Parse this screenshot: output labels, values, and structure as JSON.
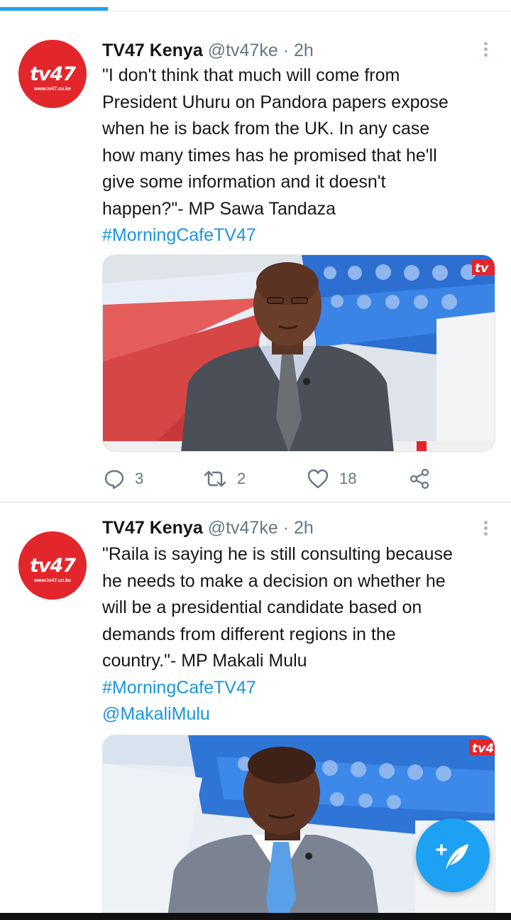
{
  "tweets": [
    {
      "name": "TV47 Kenya",
      "handle": "@tv47ke",
      "separator": "·",
      "time": "2h",
      "avatar_logo": "tv47",
      "avatar_url": "www.tv47.co.ke",
      "text": "\"I don't think that much will come from\nPresident Uhuru on Pandora papers expose\nwhen he is back from the UK. In any case\nhow many times  has he promised that he'll\ngive some information and it doesn't\nhappen?\"- MP Sawa Tandaza",
      "links": [
        "#MorningCafeTV47"
      ],
      "media_logo": "tv",
      "replies": "3",
      "retweets": "2",
      "likes": "18"
    },
    {
      "name": "TV47 Kenya",
      "handle": "@tv47ke",
      "separator": "·",
      "time": "2h",
      "avatar_logo": "tv47",
      "avatar_url": "www.tv47.co.ke",
      "text": "\"Raila is saying he is still consulting because\nhe needs to make a decision on whether he\nwill be a presidential candidate based on\ndemands from different regions in the\ncountry.\"- MP Makali Mulu",
      "links": [
        " #MorningCafeTV47",
        "@MakaliMulu"
      ],
      "media_logo": "tv4"
    }
  ],
  "icons": {
    "reply": "reply-icon",
    "retweet": "retweet-icon",
    "like": "heart-icon",
    "share": "share-icon",
    "more": "more-vertical-icon",
    "compose": "compose-tweet-icon"
  },
  "colors": {
    "accent": "#1da1f2",
    "link": "#1b95e0",
    "brand": "#e3262b",
    "secondary_text": "#657786"
  }
}
